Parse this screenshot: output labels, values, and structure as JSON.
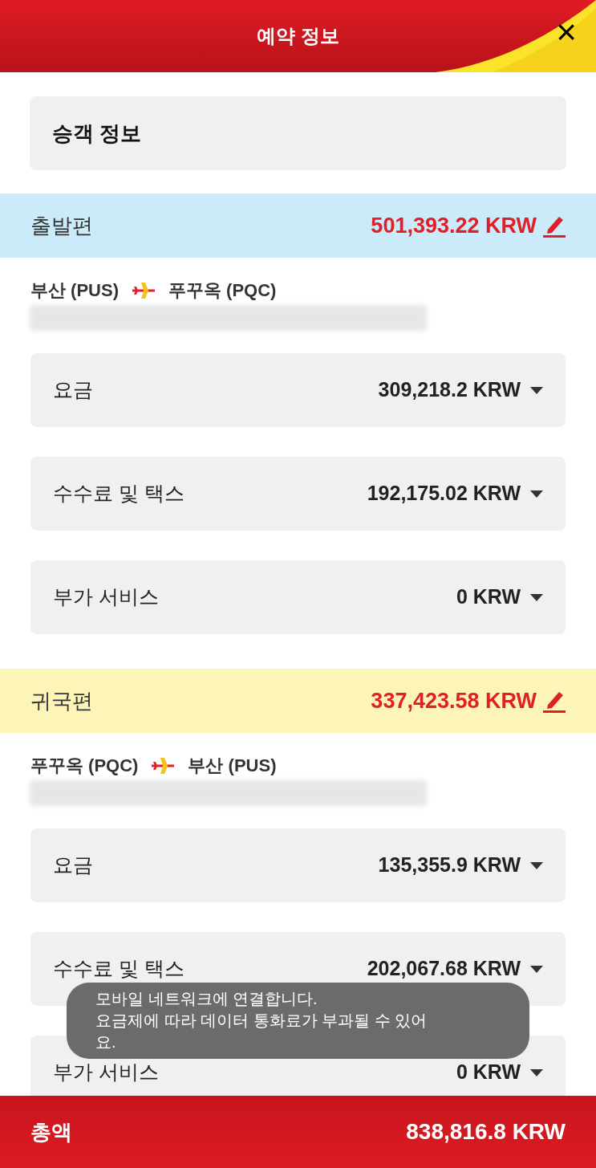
{
  "header": {
    "title": "예약 정보",
    "close": "×"
  },
  "passenger": {
    "label": "승객 정보"
  },
  "sections": [
    {
      "kind": "outbound",
      "label": "출발편",
      "total": "501,393.22 KRW",
      "from": "부산 (PUS)",
      "to": "푸꾸옥 (PQC)",
      "rows": [
        {
          "label": "요금",
          "amount": "309,218.2 KRW"
        },
        {
          "label": "수수료 및 택스",
          "amount": "192,175.02 KRW"
        },
        {
          "label": "부가 서비스",
          "amount": "0 KRW"
        }
      ]
    },
    {
      "kind": "return",
      "label": "귀국편",
      "total": "337,423.58 KRW",
      "from": "푸꾸옥 (PQC)",
      "to": "부산 (PUS)",
      "rows": [
        {
          "label": "요금",
          "amount": "135,355.9 KRW"
        },
        {
          "label": "수수료 및 택스",
          "amount": "202,067.68 KRW"
        },
        {
          "label": "부가 서비스",
          "amount": "0 KRW"
        }
      ]
    }
  ],
  "toast": {
    "lines": [
      "모바일 네트워크에 연결합니다.",
      "요금제에 따라 데이터 통화료가 부과될 수 있어요."
    ]
  },
  "footer": {
    "label": "총액",
    "amount": "838,816.8 KRW"
  }
}
